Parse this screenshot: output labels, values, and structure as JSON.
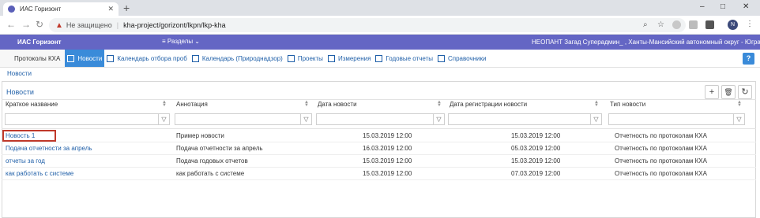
{
  "browser": {
    "tab_title": "ИАС Горизонт",
    "close_glyph": "✕",
    "new_tab_glyph": "+",
    "win": [
      "–",
      "□",
      "✕"
    ],
    "not_secure": "Не защищено",
    "separator": "|",
    "url": "kha-project/gorizont/lkpn/lkp-kha",
    "profile_initial": "N"
  },
  "app": {
    "brand": "ИАС Горизонт",
    "menu_label": "≡ Разделы ⌄",
    "user": "НЕОПАНТ Загад Суперадмин_ , Ханты-Мансийский автономный округ - Югра ⌄",
    "accent": "#6466c4"
  },
  "subnav": {
    "first": "Протоколы КХА",
    "items": [
      {
        "label": "Новости",
        "active": true
      },
      {
        "label": "Календарь отбора проб"
      },
      {
        "label": "Календарь (Природнадзор)"
      },
      {
        "label": "Проекты"
      },
      {
        "label": "Измерения"
      },
      {
        "label": "Годовые отчеты"
      },
      {
        "label": "Справочники"
      }
    ],
    "help": "?"
  },
  "breadcrumb": "Новости",
  "panel": {
    "title": "Новости",
    "buttons": {
      "add": "+",
      "delete": "🗑",
      "refresh": "↻"
    }
  },
  "table": {
    "columns": [
      "Краткое название",
      "Аннотация",
      "Дата новости",
      "Дата регистрации новости",
      "Тип новости"
    ],
    "filter_icon": "▽",
    "rows": [
      {
        "name": "Новость 1",
        "annotation": "Пример новости",
        "date": "15.03.2019 12:00",
        "reg_date": "15.03.2019 12:00",
        "type": "Отчетность по протоколам КХА"
      },
      {
        "name": "Подача отчетности за апрель",
        "annotation": "Подача отчетности за апрель",
        "date": "16.03.2019 12:00",
        "reg_date": "05.03.2019 12:00",
        "type": "Отчетность по протоколам КХА"
      },
      {
        "name": "отчеты за год",
        "annotation": "Подача годовых отчетов",
        "date": "15.03.2019 12:00",
        "reg_date": "15.03.2019 12:00",
        "type": "Отчетность по протоколам КХА"
      },
      {
        "name": "как работать с системе",
        "annotation": "как работать с системе",
        "date": "15.03.2019 12:00",
        "reg_date": "07.03.2019 12:00",
        "type": "Отчетность по протоколам КХА"
      }
    ]
  }
}
